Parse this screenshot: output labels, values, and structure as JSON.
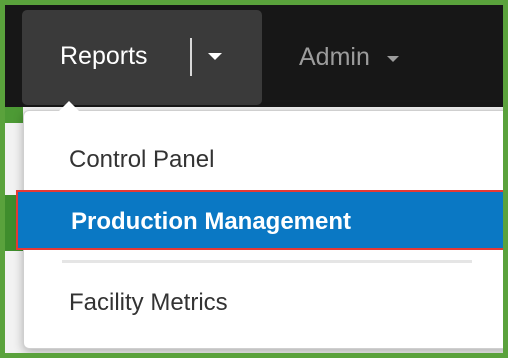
{
  "navbar": {
    "reports_label": "Reports",
    "admin_label": "Admin"
  },
  "dropdown": {
    "items": [
      {
        "label": "Control Panel",
        "active": false
      },
      {
        "label": "Production Management",
        "active": true
      },
      {
        "label": "Facility Metrics",
        "active": false
      }
    ]
  },
  "colors": {
    "navbar_bg": "#171717",
    "active_bg": "#0a78c4",
    "highlight_border": "#e53935",
    "frame_border": "#5aa23c"
  },
  "icons": {
    "reports_caret": "caret-down-icon",
    "admin_caret": "caret-down-icon"
  }
}
